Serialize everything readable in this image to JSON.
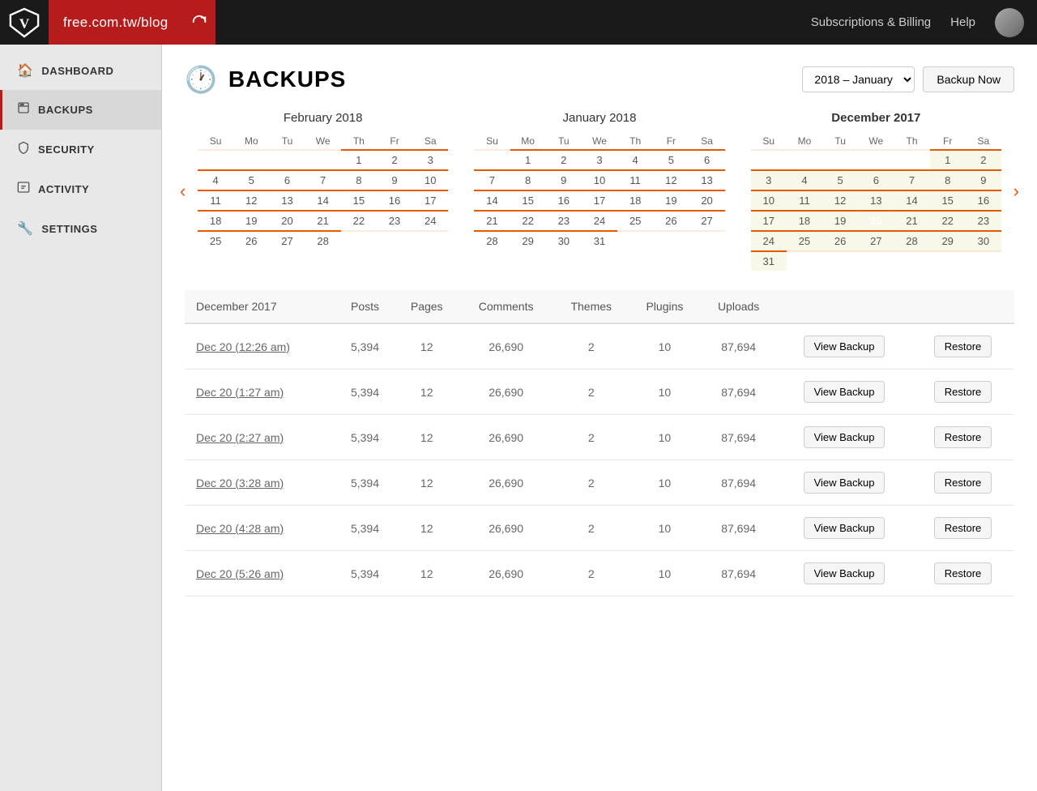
{
  "header": {
    "url": "free.com.tw/blog",
    "subscriptions_label": "Subscriptions & Billing",
    "help_label": "Help"
  },
  "sidebar": {
    "items": [
      {
        "id": "dashboard",
        "label": "Dashboard",
        "icon": "🏠"
      },
      {
        "id": "backups",
        "label": "Backups",
        "icon": "🛡",
        "active": true
      },
      {
        "id": "security",
        "label": "Security",
        "icon": "🛡"
      },
      {
        "id": "activity",
        "label": "Activity",
        "icon": "📊"
      },
      {
        "id": "settings",
        "label": "Settings",
        "icon": "🔧"
      }
    ]
  },
  "page": {
    "title": "Backups",
    "month_select_value": "2018 – January",
    "backup_now_label": "Backup Now"
  },
  "calendars": [
    {
      "title": "February 2018",
      "bold": false,
      "days": [
        "Su",
        "Mo",
        "Tu",
        "We",
        "Th",
        "Fr",
        "Sa"
      ],
      "weeks": [
        [
          null,
          null,
          null,
          null,
          1,
          2,
          3
        ],
        [
          4,
          5,
          6,
          7,
          8,
          9,
          10
        ],
        [
          11,
          12,
          13,
          14,
          15,
          16,
          17
        ],
        [
          18,
          19,
          20,
          21,
          22,
          23,
          24
        ],
        [
          25,
          26,
          27,
          28,
          null,
          null,
          null
        ]
      ],
      "backup_days": [
        1,
        2,
        3,
        4,
        5,
        6,
        7,
        8,
        9,
        10,
        11,
        12,
        13,
        14,
        15,
        16,
        17,
        18,
        19,
        20,
        21,
        22,
        23,
        24,
        25,
        26,
        27,
        28
      ],
      "today": null,
      "highlighted": false
    },
    {
      "title": "January 2018",
      "bold": false,
      "days": [
        "Su",
        "Mo",
        "Tu",
        "We",
        "Th",
        "Fr",
        "Sa"
      ],
      "weeks": [
        [
          null,
          1,
          2,
          3,
          4,
          5,
          6
        ],
        [
          7,
          8,
          9,
          10,
          11,
          12,
          13
        ],
        [
          14,
          15,
          16,
          17,
          18,
          19,
          20
        ],
        [
          21,
          22,
          23,
          24,
          25,
          26,
          27
        ],
        [
          28,
          29,
          30,
          31,
          null,
          null,
          null
        ]
      ],
      "backup_days": [
        1,
        2,
        3,
        4,
        5,
        6,
        7,
        8,
        9,
        10,
        11,
        12,
        13,
        14,
        15,
        16,
        17,
        18,
        19,
        20,
        21,
        22,
        23,
        24,
        25,
        26,
        27,
        28,
        29,
        30,
        31
      ],
      "today": null,
      "highlighted": false
    },
    {
      "title": "December 2017",
      "bold": true,
      "days": [
        "Su",
        "Mo",
        "Tu",
        "We",
        "Th",
        "Fr",
        "Sa"
      ],
      "weeks": [
        [
          null,
          null,
          null,
          null,
          null,
          1,
          2
        ],
        [
          3,
          4,
          5,
          6,
          7,
          8,
          9
        ],
        [
          10,
          11,
          12,
          13,
          14,
          15,
          16
        ],
        [
          17,
          18,
          19,
          20,
          21,
          22,
          23
        ],
        [
          24,
          25,
          26,
          27,
          28,
          29,
          30
        ],
        [
          31,
          null,
          null,
          null,
          null,
          null,
          null
        ]
      ],
      "backup_days": [
        1,
        2,
        3,
        4,
        5,
        6,
        7,
        8,
        9,
        10,
        11,
        12,
        13,
        14,
        15,
        16,
        17,
        18,
        19,
        20,
        21,
        22,
        23,
        24,
        25,
        26,
        27,
        28,
        29,
        30,
        31
      ],
      "today": 20,
      "highlighted": true
    }
  ],
  "table": {
    "headers": [
      "December 2017",
      "Posts",
      "Pages",
      "Comments",
      "Themes",
      "Plugins",
      "Uploads",
      "",
      ""
    ],
    "rows": [
      {
        "date": "Dec 20 (12:26 am)",
        "posts": "5,394",
        "pages": "12",
        "comments": "26,690",
        "themes": "2",
        "plugins": "10",
        "uploads": "87,694"
      },
      {
        "date": "Dec 20 (1:27 am)",
        "posts": "5,394",
        "pages": "12",
        "comments": "26,690",
        "themes": "2",
        "plugins": "10",
        "uploads": "87,694"
      },
      {
        "date": "Dec 20 (2:27 am)",
        "posts": "5,394",
        "pages": "12",
        "comments": "26,690",
        "themes": "2",
        "plugins": "10",
        "uploads": "87,694"
      },
      {
        "date": "Dec 20 (3:28 am)",
        "posts": "5,394",
        "pages": "12",
        "comments": "26,690",
        "themes": "2",
        "plugins": "10",
        "uploads": "87,694"
      },
      {
        "date": "Dec 20 (4:28 am)",
        "posts": "5,394",
        "pages": "12",
        "comments": "26,690",
        "themes": "2",
        "plugins": "10",
        "uploads": "87,694"
      },
      {
        "date": "Dec 20 (5:26 am)",
        "posts": "5,394",
        "pages": "12",
        "comments": "26,690",
        "themes": "2",
        "plugins": "10",
        "uploads": "87,694"
      }
    ],
    "view_label": "View Backup",
    "restore_label": "Restore"
  }
}
